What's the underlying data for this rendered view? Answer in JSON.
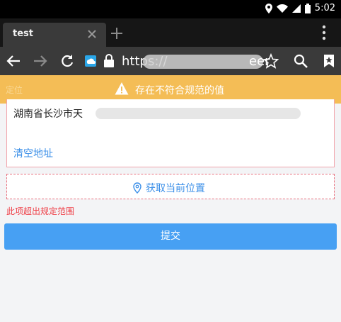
{
  "status_bar": {
    "time": "5:02",
    "icons": [
      "location-icon",
      "wifi-icon",
      "signal-icon",
      "battery-icon"
    ]
  },
  "browser": {
    "tab_title": "test",
    "url_display": "https://",
    "url_tail": "eer"
  },
  "warning": {
    "message": "存在不符合规范的值",
    "faint_label": "定位",
    "color": "#f4bd56"
  },
  "form": {
    "address_text": "湖南省长沙市天",
    "clear_address": "清空地址",
    "locate_button": "获取当前位置",
    "error_message": "此项超出规定范围",
    "submit_button": "提交"
  },
  "colors": {
    "accent": "#47a0f3",
    "link": "#3b8fe8",
    "error": "#ef3f47",
    "error_border": "#e8707e"
  }
}
